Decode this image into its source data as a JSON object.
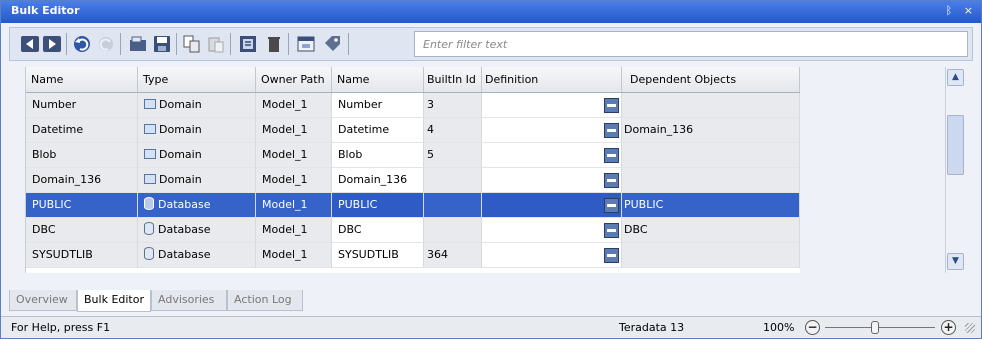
{
  "window": {
    "title": "Bulk Editor",
    "pin_glyph": "ᛒ",
    "close_glyph": "×"
  },
  "toolbar": {
    "buttons": [
      "prev-icon",
      "next-icon",
      "undo-icon",
      "redo-icon",
      "open-icon",
      "save-icon",
      "copy-icon",
      "paste-icon",
      "properties-icon",
      "delete-icon",
      "view-icon",
      "tag-icon"
    ],
    "filter_placeholder": "Enter filter text"
  },
  "table": {
    "columns": [
      "Name",
      "Type",
      "Owner Path",
      "Name",
      "BuiltIn Id",
      "Definition",
      "Dependent Objects"
    ],
    "rows": [
      {
        "name": "Number",
        "type": "Domain",
        "type_icon": "domain-icon",
        "owner": "Model_1",
        "name2": "Number",
        "builtin_id": "3",
        "definition": "",
        "dependents": "",
        "selected": false
      },
      {
        "name": "Datetime",
        "type": "Domain",
        "type_icon": "domain-icon",
        "owner": "Model_1",
        "name2": "Datetime",
        "builtin_id": "4",
        "definition": "",
        "dependents": "Domain_136",
        "selected": false
      },
      {
        "name": "Blob",
        "type": "Domain",
        "type_icon": "domain-icon",
        "owner": "Model_1",
        "name2": "Blob",
        "builtin_id": "5",
        "definition": "",
        "dependents": "",
        "selected": false
      },
      {
        "name": "Domain_136",
        "type": "Domain",
        "type_icon": "domain-icon",
        "owner": "Model_1",
        "name2": "Domain_136",
        "builtin_id": "",
        "definition": "",
        "dependents": "",
        "selected": false
      },
      {
        "name": "PUBLIC",
        "type": "Database",
        "type_icon": "database-icon",
        "owner": "Model_1",
        "name2": "PUBLIC",
        "builtin_id": "",
        "definition": "",
        "dependents": "PUBLIC",
        "selected": true
      },
      {
        "name": "DBC",
        "type": "Database",
        "type_icon": "database-icon",
        "owner": "Model_1",
        "name2": "DBC",
        "builtin_id": "",
        "definition": "",
        "dependents": "DBC",
        "selected": false
      },
      {
        "name": "SYSUDTLIB",
        "type": "Database",
        "type_icon": "database-icon",
        "owner": "Model_1",
        "name2": "SYSUDTLIB",
        "builtin_id": "364",
        "definition": "",
        "dependents": "",
        "selected": false
      }
    ]
  },
  "tabs": [
    {
      "label": "Overview",
      "active": false
    },
    {
      "label": "Bulk Editor",
      "active": true
    },
    {
      "label": "Advisories",
      "active": false
    },
    {
      "label": "Action Log",
      "active": false
    }
  ],
  "status": {
    "help": "For Help, press F1",
    "database": "Teradata 13",
    "zoom": "100%",
    "zoom_fraction": 0.45
  },
  "colors": {
    "titlebar": "#2f64d9",
    "selection": "#2f5cc4",
    "column_gray": "#e9eaee"
  }
}
